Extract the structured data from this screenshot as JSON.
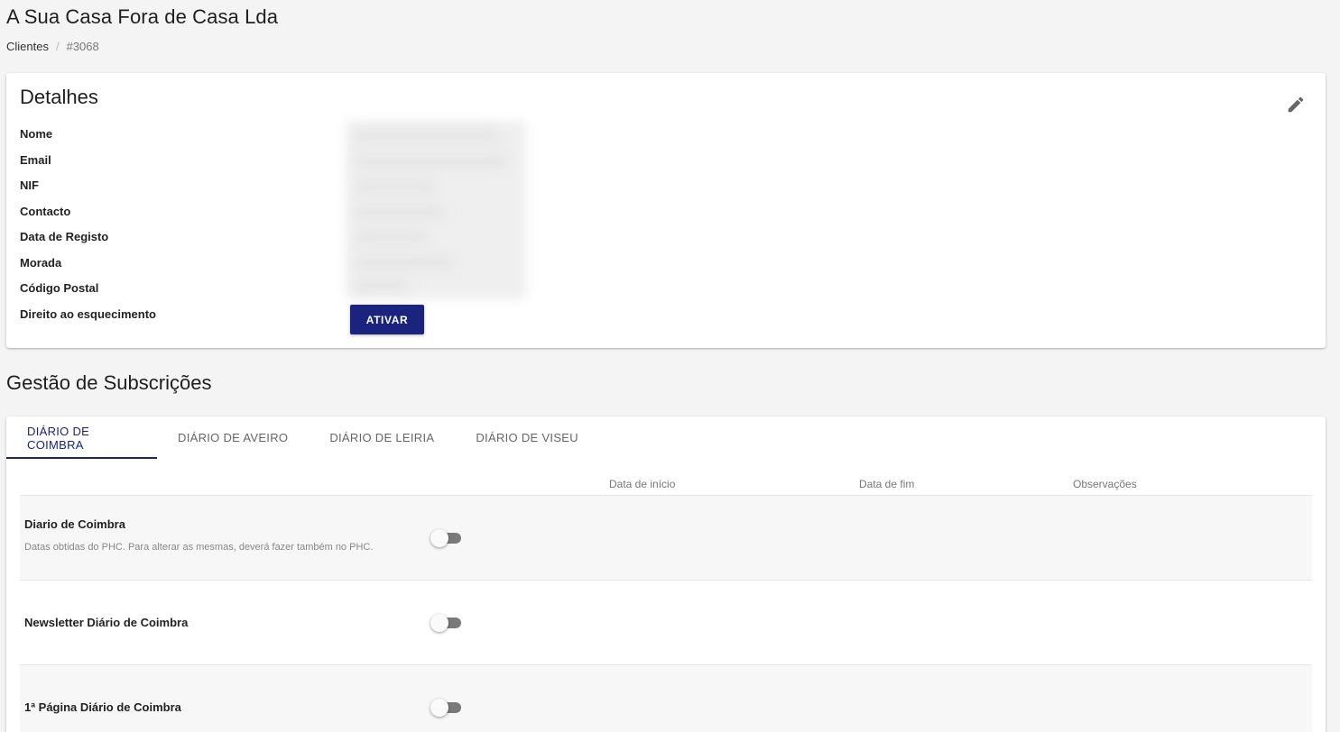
{
  "page": {
    "title": "A Sua Casa Fora de Casa Lda"
  },
  "breadcrumb": {
    "parent": "Clientes",
    "separator": "/",
    "current": "#3068"
  },
  "details": {
    "title": "Detalhes",
    "edit_icon": "pencil-icon",
    "fields": [
      {
        "label": "Nome"
      },
      {
        "label": "Email"
      },
      {
        "label": "NIF"
      },
      {
        "label": "Contacto"
      },
      {
        "label": "Data de Registo"
      },
      {
        "label": "Morada"
      },
      {
        "label": "Código Postal"
      },
      {
        "label": "Direito ao esquecimento"
      }
    ],
    "ativar_label": "ATIVAR"
  },
  "subscriptions": {
    "title": "Gestão de Subscrições",
    "tabs": [
      {
        "label": "DIÁRIO DE COIMBRA",
        "active": true
      },
      {
        "label": "DIÁRIO DE AVEIRO",
        "active": false
      },
      {
        "label": "DIÁRIO DE LEIRIA",
        "active": false
      },
      {
        "label": "DIÁRIO DE VISEU",
        "active": false
      }
    ],
    "columns": {
      "start": "Data de início",
      "end": "Data de fim",
      "notes": "Observações"
    },
    "rows": [
      {
        "title": "Diario de Coimbra",
        "description": "Datas obtidas do PHC. Para alterar as mesmas, deverá fazer também no PHC.",
        "enabled": false
      },
      {
        "title": "Newsletter Diário de Coimbra",
        "description": "",
        "enabled": false
      },
      {
        "title": "1ª Página Diário de Coimbra",
        "description": "",
        "enabled": false
      }
    ]
  },
  "colors": {
    "accent": "#1a237e",
    "background": "#f4f4f4",
    "toggle_off_track": "#7a7a7a"
  }
}
